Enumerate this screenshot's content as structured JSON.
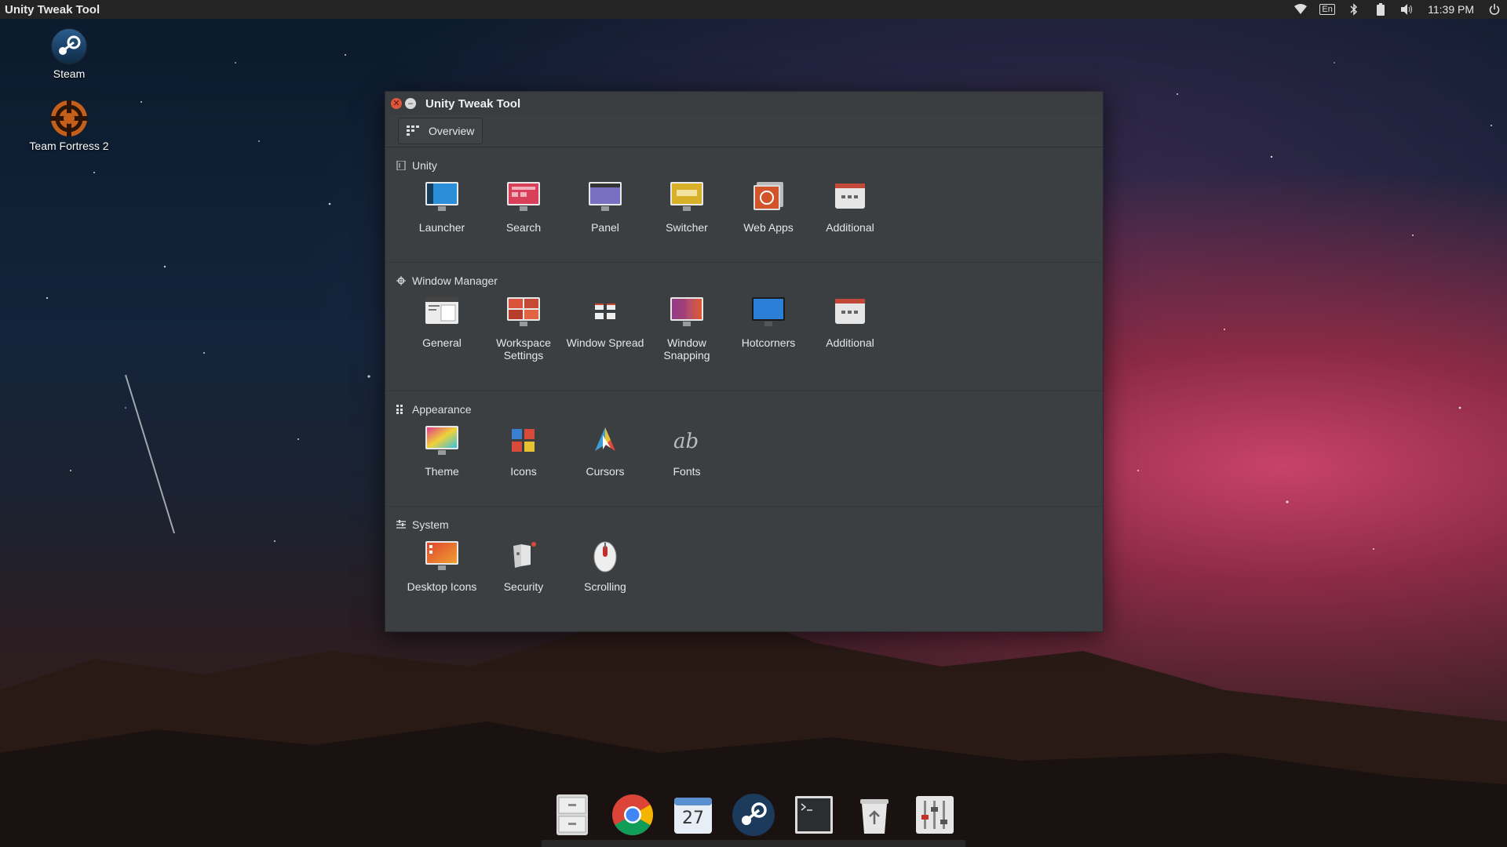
{
  "topbar": {
    "title": "Unity Tweak Tool",
    "lang": "En",
    "clock": "11:39 PM",
    "icons": [
      "wifi-icon",
      "keyboard-layout-icon",
      "bluetooth-icon",
      "battery-icon",
      "volume-icon",
      "power-icon"
    ]
  },
  "desktop": {
    "icons": [
      {
        "label": "Steam",
        "icon": "steam-icon"
      },
      {
        "label": "Team Fortress 2",
        "icon": "team-fortress-2-icon"
      }
    ]
  },
  "window": {
    "title": "Unity Tweak Tool",
    "overview_label": "Overview",
    "sections": [
      {
        "title": "Unity",
        "icon": "unity-icon",
        "items": [
          {
            "label": "Launcher",
            "icon": "launcher-icon"
          },
          {
            "label": "Search",
            "icon": "search-icon"
          },
          {
            "label": "Panel",
            "icon": "panel-icon"
          },
          {
            "label": "Switcher",
            "icon": "switcher-icon"
          },
          {
            "label": "Web Apps",
            "icon": "web-apps-icon"
          },
          {
            "label": "Additional",
            "icon": "additional-icon"
          }
        ]
      },
      {
        "title": "Window Manager",
        "icon": "window-manager-icon",
        "items": [
          {
            "label": "General",
            "icon": "general-icon"
          },
          {
            "label": "Workspace Settings",
            "icon": "workspace-icon"
          },
          {
            "label": "Window Spread",
            "icon": "window-spread-icon"
          },
          {
            "label": "Window Snapping",
            "icon": "window-snapping-icon"
          },
          {
            "label": "Hotcorners",
            "icon": "hotcorners-icon"
          },
          {
            "label": "Additional",
            "icon": "additional-icon"
          }
        ]
      },
      {
        "title": "Appearance",
        "icon": "appearance-icon",
        "items": [
          {
            "label": "Theme",
            "icon": "theme-icon"
          },
          {
            "label": "Icons",
            "icon": "icons-icon"
          },
          {
            "label": "Cursors",
            "icon": "cursors-icon"
          },
          {
            "label": "Fonts",
            "icon": "fonts-icon"
          }
        ]
      },
      {
        "title": "System",
        "icon": "system-icon",
        "items": [
          {
            "label": "Desktop Icons",
            "icon": "desktop-icons-icon"
          },
          {
            "label": "Security",
            "icon": "security-icon"
          },
          {
            "label": "Scrolling",
            "icon": "scrolling-icon"
          }
        ]
      }
    ]
  },
  "dock": {
    "items": [
      {
        "name": "files-icon"
      },
      {
        "name": "chrome-icon"
      },
      {
        "name": "calendar-icon",
        "label": "27"
      },
      {
        "name": "steam-icon"
      },
      {
        "name": "terminal-icon"
      },
      {
        "name": "trash-icon"
      },
      {
        "name": "unity-tweak-tool-icon"
      }
    ]
  }
}
